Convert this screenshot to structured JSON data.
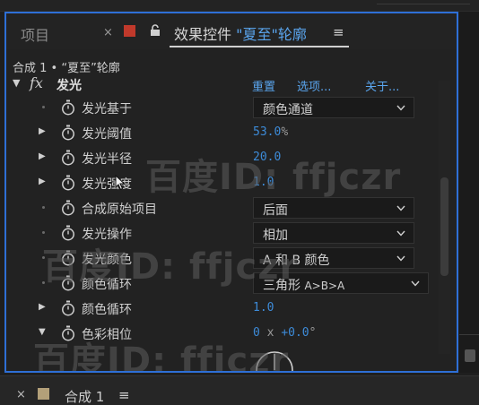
{
  "tabs": {
    "project": "项目",
    "close_symbol": "×",
    "effect_controls_prefix": "效果控件",
    "effect_controls_target": "\"夏至\"轮廓",
    "menu_symbol": "≡",
    "swatch_color": "#c0392b"
  },
  "breadcrumb": "合成 1 • “夏至”轮廓",
  "effect": {
    "name": "发光",
    "fx_symbol": "fx",
    "reset": "重置",
    "options": "选项...",
    "about": "关于..."
  },
  "properties": [
    {
      "label": "发光基于",
      "type": "dropdown",
      "value": "颜色通道",
      "expandable": false
    },
    {
      "label": "发光阈值",
      "type": "number",
      "value": "53.0",
      "unit": "%",
      "expandable": true
    },
    {
      "label": "发光半径",
      "type": "number",
      "value": "20.0",
      "unit": "",
      "expandable": true
    },
    {
      "label": "发光强度",
      "type": "number",
      "value": "1.0",
      "unit": "",
      "expandable": true
    },
    {
      "label": "合成原始项目",
      "type": "dropdown",
      "value": "后面",
      "expandable": false
    },
    {
      "label": "发光操作",
      "type": "dropdown",
      "value": "相加",
      "expandable": false
    },
    {
      "label": "发光颜色",
      "type": "dropdown",
      "value": "A 和 B 颜色",
      "expandable": false
    },
    {
      "label": "颜色循环",
      "type": "dropdown",
      "value": "三角形",
      "value_suffix": "A>B>A",
      "expandable": false
    },
    {
      "label": "颜色循环",
      "type": "number",
      "value": "1.0",
      "unit": "",
      "expandable": true
    },
    {
      "label": "色彩相位",
      "type": "angle",
      "value": "0",
      "unit_x": "x",
      "value2": "+0.0",
      "unit_deg": "°",
      "expandable": true,
      "expanded": true
    }
  ],
  "bottom_panel": {
    "close_symbol": "×",
    "title": "合成 1",
    "menu_symbol": "≡",
    "swatch_color": "#b3a079"
  },
  "watermark": "百度ID: ffjczr",
  "colors": {
    "accent_border": "#2e6fd6",
    "link_blue": "#5aa5ee",
    "value_blue": "#3d8bd8"
  }
}
